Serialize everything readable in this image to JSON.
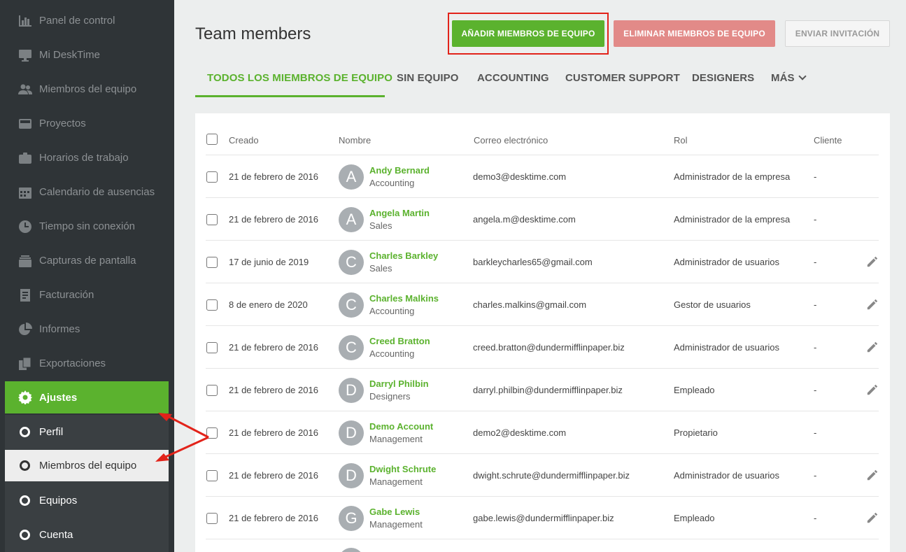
{
  "sidebar": {
    "items": [
      {
        "label": "Panel de control",
        "icon": "bar-chart-icon"
      },
      {
        "label": "Mi DeskTime",
        "icon": "monitor-icon"
      },
      {
        "label": "Miembros del equipo",
        "icon": "users-icon"
      },
      {
        "label": "Proyectos",
        "icon": "inbox-icon"
      },
      {
        "label": "Horarios de trabajo",
        "icon": "briefcase-icon"
      },
      {
        "label": "Calendario de ausencias",
        "icon": "calendar-icon"
      },
      {
        "label": "Tiempo sin conexión",
        "icon": "clock-icon"
      },
      {
        "label": "Capturas de pantalla",
        "icon": "layers-icon"
      },
      {
        "label": "Facturación",
        "icon": "invoice-icon"
      },
      {
        "label": "Informes",
        "icon": "pie-chart-icon"
      },
      {
        "label": "Exportaciones",
        "icon": "documents-icon"
      }
    ],
    "active": {
      "label": "Ajustes",
      "icon": "gear-icon"
    },
    "subitems": [
      {
        "label": "Perfil"
      },
      {
        "label": "Miembros del equipo"
      },
      {
        "label": "Equipos"
      },
      {
        "label": "Cuenta"
      }
    ]
  },
  "header": {
    "title": "Team members",
    "add_label": "AÑADIR MIEMBROS DE EQUIPO",
    "delete_label": "ELIMINAR MIEMBROS DE EQUIPO",
    "invite_label": "ENVIAR INVITACIÓN"
  },
  "tabs": [
    {
      "label": "TODOS LOS MIEMBROS DE EQUIPO"
    },
    {
      "label": "SIN EQUIPO"
    },
    {
      "label": "ACCOUNTING"
    },
    {
      "label": "CUSTOMER SUPPORT"
    },
    {
      "label": "DESIGNERS"
    },
    {
      "label": "MÁS"
    }
  ],
  "table": {
    "columns": {
      "created": "Creado",
      "name": "Nombre",
      "email": "Correo electrónico",
      "role": "Rol",
      "client": "Cliente"
    },
    "rows": [
      {
        "created": "21 de febrero de 2016",
        "initial": "A",
        "name": "Andy Bernard",
        "team": "Accounting",
        "email": "demo3@desktime.com",
        "role": "Administrador de la empresa",
        "client": "-"
      },
      {
        "created": "21 de febrero de 2016",
        "initial": "A",
        "name": "Angela Martin",
        "team": "Sales",
        "email": "angela.m@desktime.com",
        "role": "Administrador de la empresa",
        "client": "-"
      },
      {
        "created": "17 de junio de 2019",
        "initial": "C",
        "name": "Charles Barkley",
        "team": "Sales",
        "email": "barkleycharles65@gmail.com",
        "role": "Administrador de usuarios",
        "client": "-"
      },
      {
        "created": "8 de enero de 2020",
        "initial": "C",
        "name": "Charles Malkins",
        "team": "Accounting",
        "email": "charles.malkins@gmail.com",
        "role": "Gestor de usuarios",
        "client": "-"
      },
      {
        "created": "21 de febrero de 2016",
        "initial": "C",
        "name": "Creed Bratton",
        "team": "Accounting",
        "email": "creed.bratton@dundermifflinpaper.biz",
        "role": "Administrador de usuarios",
        "client": "-"
      },
      {
        "created": "21 de febrero de 2016",
        "initial": "D",
        "name": "Darryl Philbin",
        "team": "Designers",
        "email": "darryl.philbin@dundermifflinpaper.biz",
        "role": "Empleado",
        "client": "-"
      },
      {
        "created": "21 de febrero de 2016",
        "initial": "D",
        "name": "Demo Account",
        "team": "Management",
        "email": "demo2@desktime.com",
        "role": "Propietario",
        "client": "-"
      },
      {
        "created": "21 de febrero de 2016",
        "initial": "D",
        "name": "Dwight Schrute",
        "team": "Management",
        "email": "dwight.schrute@dundermifflinpaper.biz",
        "role": "Administrador de usuarios",
        "client": "-"
      },
      {
        "created": "21 de febrero de 2016",
        "initial": "G",
        "name": "Gabe Lewis",
        "team": "Management",
        "email": "gabe.lewis@dundermifflinpaper.biz",
        "role": "Empleado",
        "client": "-"
      }
    ]
  },
  "colors": {
    "accent": "#5bb22e",
    "danger": "#e28a88",
    "sidebar": "#2f3437",
    "annotation": "#e2231a"
  }
}
